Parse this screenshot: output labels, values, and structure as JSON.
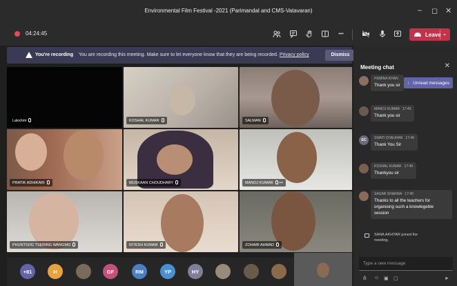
{
  "window": {
    "title": "Environmental Film Festival -2021 (Parimandal and CMS-Vatavaran)",
    "minimize_glyph": "–",
    "restore_glyph": "◻",
    "close_glyph": "✕"
  },
  "toolbar": {
    "timer": "04:24:45",
    "leave_label": "Leave",
    "more_glyph": "•••",
    "icons": [
      "people-icon",
      "chat-icon",
      "raise-hand-icon",
      "rooms-icon",
      "more-icon",
      "camera-off-icon",
      "microphone-icon",
      "share-screen-icon"
    ]
  },
  "banner": {
    "title": "You're recording",
    "message": "You are recording this meeting. Make sure to let everyone know that they are being recorded.",
    "link": "Privacy policy",
    "dismiss_label": "Dismiss"
  },
  "tiles": [
    {
      "name": "Lakshmi"
    },
    {
      "name": "KOSHAL KUMAR"
    },
    {
      "name": "SALMAN"
    },
    {
      "name": "PRATIK ADHIKARI"
    },
    {
      "name": "MUSKAAN CHOUDHARY"
    },
    {
      "name": "MANOJ KUMAR",
      "extra": "•••"
    },
    {
      "name": "PHUNTSOG TSERING WANGMO"
    },
    {
      "name": "RITESH KUMAR"
    },
    {
      "name": "ZOHAIR AHMAD"
    }
  ],
  "roster": {
    "overflow_count": "+81",
    "avatars": [
      {
        "initials": "H",
        "color": "#e8a33c"
      },
      {
        "initials": "",
        "color": "#7a6a5a",
        "photo": true
      },
      {
        "initials": "GF",
        "color": "#c3527a"
      },
      {
        "initials": "RM",
        "color": "#4a7fc4"
      },
      {
        "initials": "YP",
        "color": "#4a8fd0"
      },
      {
        "initials": "HY",
        "color": "#7f7f9a"
      },
      {
        "initials": "",
        "color": "#9a8a7a",
        "photo": true
      },
      {
        "initials": "",
        "color": "#6a5a4a",
        "photo": true
      },
      {
        "initials": "",
        "color": "#8a6a4a",
        "photo": true
      }
    ]
  },
  "chat": {
    "title": "Meeting chat",
    "close_glyph": "✕",
    "unread_label": "Unread messages",
    "messages": [
      {
        "author": "HUMINA KHAN",
        "time": "",
        "text": "Thank you sir",
        "avatar": "photo"
      },
      {
        "author": "MANOJ KUMAR",
        "time": "17:49",
        "text": "Thank you sir",
        "avatar": "photo"
      },
      {
        "author": "SWATI CHAUHAN",
        "time": "17:49",
        "text": "Thank You Sir",
        "avatar": "SC"
      },
      {
        "author": "KOSHAL KUMAR",
        "time": "17:49",
        "text": "Thankyou sir",
        "avatar": "photo"
      },
      {
        "author": "SAGAR SHARMA",
        "time": "17:49",
        "text": "Thanks to all the teachers for organising such a knowlegeble session",
        "avatar": "photo"
      }
    ],
    "system_message": "SANA AKHTAR joined the meeting.",
    "composer_placeholder": "Type a new message"
  }
}
